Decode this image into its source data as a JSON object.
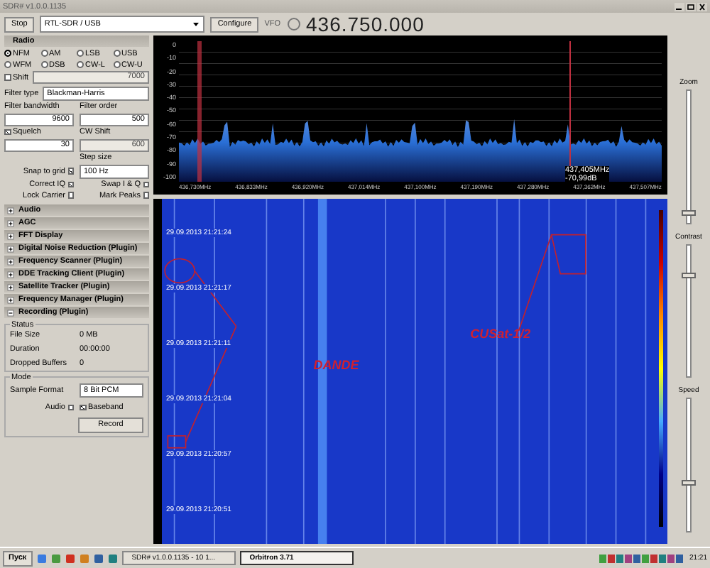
{
  "window": {
    "title": "SDR# v1.0.0.1135"
  },
  "toolbar": {
    "stop_button": "Stop",
    "source": "RTL-SDR / USB",
    "configure_button": "Configure",
    "vfo_label": "VFO",
    "frequency": "436.750.000"
  },
  "radio": {
    "title": "Radio",
    "modes": [
      {
        "label": "NFM",
        "selected": true
      },
      {
        "label": "AM",
        "selected": false
      },
      {
        "label": "LSB",
        "selected": false
      },
      {
        "label": "USB",
        "selected": false
      },
      {
        "label": "WFM",
        "selected": false
      },
      {
        "label": "DSB",
        "selected": false
      },
      {
        "label": "CW-L",
        "selected": false
      },
      {
        "label": "CW-U",
        "selected": false
      }
    ],
    "shift": {
      "label": "Shift",
      "checked": false,
      "value": "7000"
    },
    "filter_type": {
      "label": "Filter type",
      "value": "Blackman-Harris"
    },
    "filter_bandwidth": {
      "label": "Filter bandwidth",
      "value": "9600"
    },
    "filter_order": {
      "label": "Filter order",
      "value": "500"
    },
    "squelch": {
      "label": "Squelch",
      "checked": true,
      "value": "30"
    },
    "cw_shift": {
      "label": "CW Shift",
      "value": "600"
    },
    "step_size": {
      "label": "Step size",
      "value": "100 Hz"
    },
    "snap_to_grid": {
      "label": "Snap to grid",
      "checked": true
    },
    "checks": [
      {
        "label": "Correct IQ",
        "checked": true
      },
      {
        "label": "Swap I & Q",
        "checked": false
      },
      {
        "label": "Lock Carrier",
        "checked": false
      },
      {
        "label": "Mark Peaks",
        "checked": false
      }
    ]
  },
  "panels": [
    {
      "label": "Audio",
      "expanded": false
    },
    {
      "label": "AGC",
      "expanded": false
    },
    {
      "label": "FFT Display",
      "expanded": false
    },
    {
      "label": "Digital Noise Reduction (Plugin)",
      "expanded": false
    },
    {
      "label": "Frequency Scanner (Plugin)",
      "expanded": false
    },
    {
      "label": "DDE Tracking Client (Plugin)",
      "expanded": false
    },
    {
      "label": "Satellite Tracker (Plugin)",
      "expanded": false
    },
    {
      "label": "Frequency Manager (Plugin)",
      "expanded": false
    },
    {
      "label": "Recording (Plugin)",
      "expanded": true
    }
  ],
  "status": {
    "title": "Status",
    "rows": [
      {
        "label": "File Size",
        "value": "0 MB"
      },
      {
        "label": "Duration",
        "value": "00:00:00"
      },
      {
        "label": "Dropped Buffers",
        "value": "0"
      }
    ]
  },
  "mode": {
    "title": "Mode",
    "sample_format_label": "Sample Format",
    "sample_format": "8 Bit PCM",
    "audio": {
      "label": "Audio",
      "checked": false
    },
    "baseband": {
      "label": "Baseband",
      "checked": true
    },
    "record_button": "Record"
  },
  "spectrum": {
    "y_labels": [
      "0",
      "-10",
      "-20",
      "-30",
      "-40",
      "-50",
      "-60",
      "-70",
      "-80",
      "-90",
      "-100"
    ],
    "x_labels": [
      "436,730MHz",
      "436,833MHz",
      "436,920MHz",
      "437,014MHz",
      "437,100MHz",
      "437,190MHz",
      "437,280MHz",
      "437,362MHz",
      "437,507MHz"
    ],
    "cursor_frequency": "437,405MHz",
    "cursor_level": "-70,99dB"
  },
  "sliders": [
    {
      "label": "Zoom",
      "level": 0.05
    },
    {
      "label": "Contrast",
      "level": 0.75
    },
    {
      "label": "Speed",
      "level": 0.35
    }
  ],
  "waterfall": {
    "timestamps": [
      "29.09.2013 21:21:24",
      "29.09.2013 21:21:17",
      "29.09.2013 21:21:11",
      "29.09.2013 21:21:04",
      "29.09.2013 21:20:57",
      "29.09.2013 21:20:51"
    ],
    "annotations": [
      {
        "label": "DANDE"
      },
      {
        "label": "CUSat-1/2"
      }
    ]
  },
  "taskbar": {
    "start_button": "Пуск",
    "tasks": [
      {
        "label": "SDR# v1.0.0.1135 - 10 1...",
        "selected": false
      },
      {
        "label": "Orbitron 3.71",
        "selected": true
      }
    ],
    "clock": "21:21"
  }
}
